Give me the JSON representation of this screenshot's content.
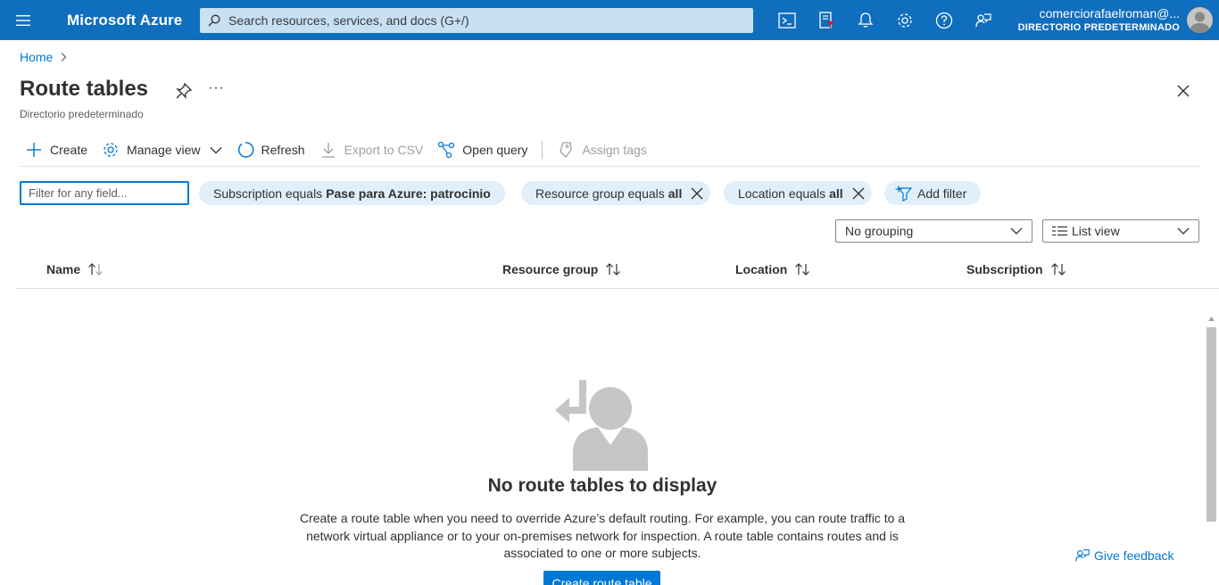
{
  "topbar": {
    "brand": "Microsoft Azure",
    "search_placeholder": "Search resources, services, and docs (G+/)",
    "account_email": "comerciorafaelroman@...",
    "account_directory": "DIRECTORIO PREDETERMINADO",
    "icons": [
      "cloud-shell-icon",
      "directory-filter-icon",
      "notifications-icon",
      "settings-icon",
      "help-icon",
      "feedback-icon"
    ]
  },
  "breadcrumb": {
    "home": "Home"
  },
  "header": {
    "title": "Route tables",
    "more": "···",
    "subtitle": "Directorio predeterminado"
  },
  "commands": {
    "create": "Create",
    "manage_view": "Manage view",
    "refresh": "Refresh",
    "export_csv": "Export to CSV",
    "open_query": "Open query",
    "assign_tags": "Assign tags"
  },
  "filters": {
    "input_placeholder": "Filter for any field...",
    "subscription_prefix": "Subscription equals",
    "subscription_value": "Pase para Azure: patrocinio",
    "resource_group_prefix": "Resource group equals",
    "resource_group_value": "all",
    "location_prefix": "Location equals",
    "location_value": "all",
    "add_filter": "Add filter"
  },
  "view": {
    "grouping": "No grouping",
    "view_mode": "List view"
  },
  "table": {
    "columns": [
      "Name",
      "Resource group",
      "Location",
      "Subscription"
    ]
  },
  "empty_state": {
    "title": "No route tables to display",
    "description": "Create a route table when you need to override Azure’s default routing. For example, you can route traffic to a network virtual appliance or to your on-premises network for inspection. A route table contains routes and is associated to one or more subjects.",
    "button": "Create route table"
  },
  "feedback": "Give feedback",
  "colors": {
    "accent": "#0078d4",
    "topbar": "#106ebe",
    "pill": "#e1effa"
  }
}
